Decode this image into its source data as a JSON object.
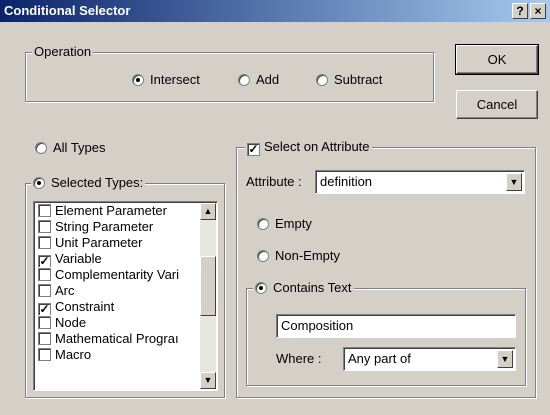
{
  "window": {
    "title": "Conditional Selector",
    "help_label": "?",
    "close_label": "×"
  },
  "operation": {
    "label": "Operation",
    "options": [
      "Intersect",
      "Add",
      "Subtract"
    ],
    "selected": "Intersect"
  },
  "buttons": {
    "ok": "OK",
    "cancel": "Cancel"
  },
  "types": {
    "all_types_label": "All Types",
    "selected_types_label": "Selected Types:",
    "selected_option": "Selected Types",
    "items": [
      {
        "label": "Element Parameter",
        "checked": false
      },
      {
        "label": "String Parameter",
        "checked": false
      },
      {
        "label": "Unit Parameter",
        "checked": false
      },
      {
        "label": "Variable",
        "checked": true
      },
      {
        "label": "Complementarity Vari",
        "checked": false
      },
      {
        "label": "Arc",
        "checked": false
      },
      {
        "label": "Constraint",
        "checked": true
      },
      {
        "label": "Node",
        "checked": false
      },
      {
        "label": "Mathematical Prograı",
        "checked": false
      },
      {
        "label": "Macro",
        "checked": false
      }
    ]
  },
  "attribute": {
    "select_on_attribute_label": "Select on Attribute",
    "select_on_attribute_checked": true,
    "attribute_label": "Attribute :",
    "attribute_value": "definition",
    "empty_label": "Empty",
    "non_empty_label": "Non-Empty",
    "contains_text_label": "Contains Text",
    "selected_mode": "Contains Text",
    "text_value": "Composition",
    "where_label": "Where :",
    "where_value": "Any part of"
  }
}
